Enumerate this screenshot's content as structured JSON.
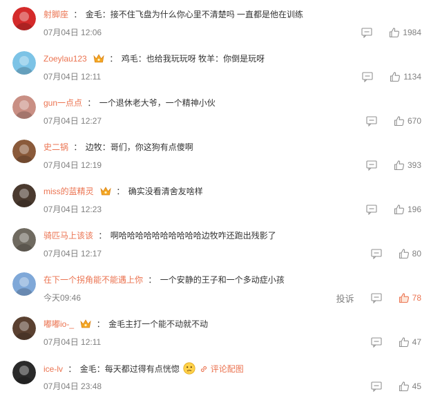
{
  "comments": [
    {
      "user": "射脚座",
      "text": "金毛：接不住飞盘为什么你心里不清楚吗 一直都是他在训练",
      "time": "07月04日 12:06",
      "likes": "1984",
      "crown": false,
      "avatar_color": "#d42a2a"
    },
    {
      "user": "Zoeylau123",
      "text": "鸡毛：也给我玩玩呀 牧羊：你倒是玩呀",
      "time": "07月04日 12:11",
      "likes": "1134",
      "crown": true,
      "avatar_color": "#7cc3e6"
    },
    {
      "user": "gun一点点",
      "text": "一个退休老大爷，一个精神小伙",
      "time": "07月04日 12:27",
      "likes": "670",
      "crown": false,
      "avatar_color": "#c98f84"
    },
    {
      "user": "史二锅",
      "text": "边牧：哥们，你这狗有点傻啊",
      "time": "07月04日 12:19",
      "likes": "393",
      "crown": false,
      "avatar_color": "#8a5a3a"
    },
    {
      "user": "miss的蓝精灵",
      "text": "确实没看清舍友啥样",
      "time": "07月04日 12:23",
      "likes": "196",
      "crown": true,
      "avatar_color": "#4a3a2f"
    },
    {
      "user": "骑匹马上该该",
      "text": "啊哈哈哈哈哈哈哈哈哈哈边牧咋还跑出残影了",
      "time": "07月04日 12:17",
      "likes": "80",
      "crown": false,
      "avatar_color": "#6f6a60"
    },
    {
      "user": "在下一个拐角能不能遇上你",
      "text": "一个安静的王子和一个多动症小孩",
      "time": "今天09:46",
      "likes": "78",
      "crown": false,
      "report": "投诉",
      "liked": true,
      "avatar_color": "#7fa8d8"
    },
    {
      "user": "嘟嘟io-_",
      "text": "金毛主打一个能不动就不动",
      "time": "07月04日 12:11",
      "likes": "47",
      "crown": true,
      "avatar_color": "#5a4030"
    },
    {
      "user": "ice-lv",
      "text": "金毛：每天都过得有点恍惚",
      "time": "07月04日 23:48",
      "likes": "45",
      "crown": false,
      "emoji": "thinking-emoji",
      "link": "评论配图",
      "avatar_color": "#2a2a2a"
    }
  ],
  "colors": {
    "username": "#eb7350",
    "text": "#333333",
    "meta": "#808080",
    "liked": "#eb7350",
    "crown": "#f4a623"
  },
  "icons": {
    "reply": "reply-icon",
    "like": "thumbs-up-icon",
    "vip": "crown-icon",
    "image_link": "image-link-icon"
  }
}
